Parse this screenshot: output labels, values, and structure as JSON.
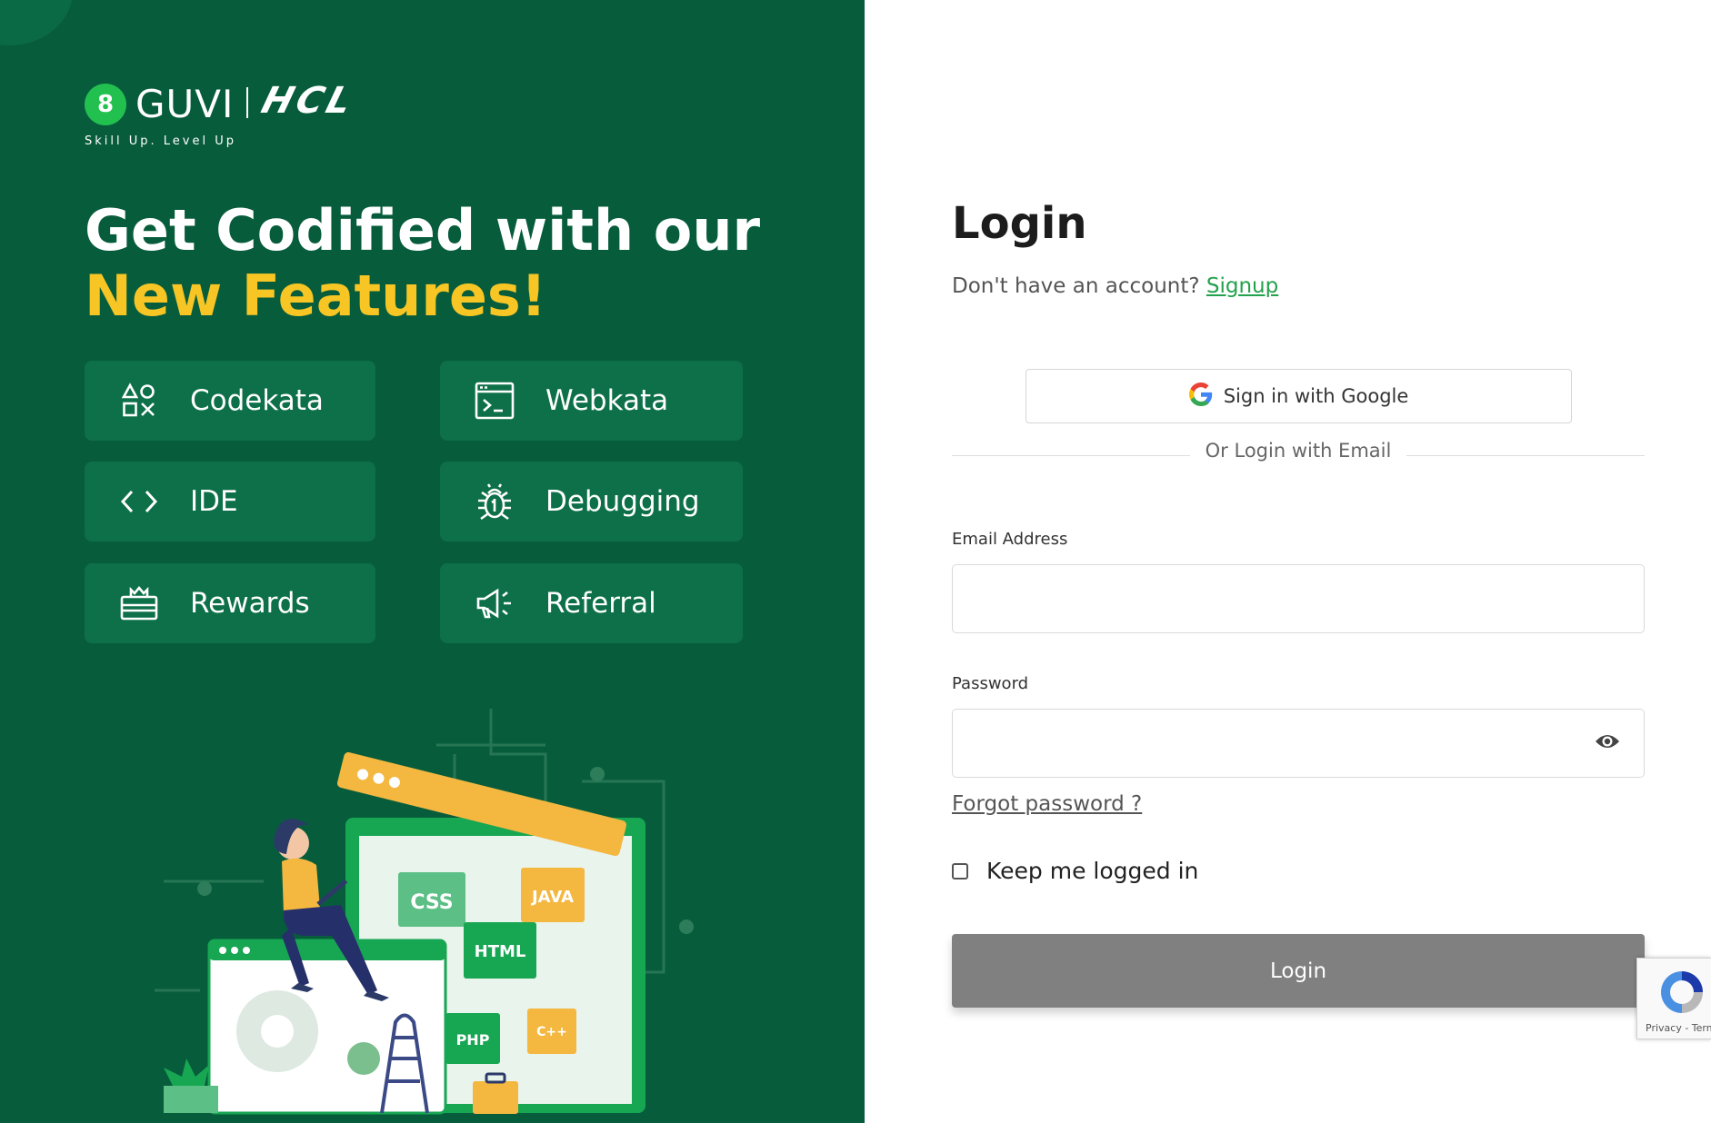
{
  "brand": {
    "logo_letter": "8",
    "name": "GUVI",
    "partner": "HCL",
    "tagline": "Skill Up. Level Up"
  },
  "hero": {
    "headline_main": "Get Codified with our ",
    "headline_highlight": "New Features!"
  },
  "features": [
    {
      "label": "Codekata",
      "icon": "shapes-icon"
    },
    {
      "label": "Webkata",
      "icon": "terminal-window-icon"
    },
    {
      "label": "IDE",
      "icon": "code-brackets-icon"
    },
    {
      "label": "Debugging",
      "icon": "bug-icon"
    },
    {
      "label": "Rewards",
      "icon": "gift-box-icon"
    },
    {
      "label": "Referral",
      "icon": "megaphone-icon"
    }
  ],
  "illustration": {
    "tags": [
      "CSS",
      "JAVA",
      "HTML",
      "PHP",
      "C++"
    ]
  },
  "login": {
    "title": "Login",
    "no_account_text": "Don't have an account? ",
    "signup_label": "Signup",
    "google_label": "Sign in with Google",
    "or_text": "Or Login with Email",
    "email_label": "Email Address",
    "email_value": "",
    "email_placeholder": "",
    "password_label": "Password",
    "password_value": "",
    "forgot_label": "Forgot password ?",
    "keep_label": "Keep me logged in",
    "keep_checked": false,
    "submit_label": "Login"
  },
  "recaptcha": {
    "footer_text": "Privacy - Terms"
  },
  "colors": {
    "panel_green": "#075c3c",
    "card_green": "#0d7049",
    "highlight_yellow": "#f7c625",
    "link_green": "#23a24d",
    "button_gray": "#808080"
  }
}
